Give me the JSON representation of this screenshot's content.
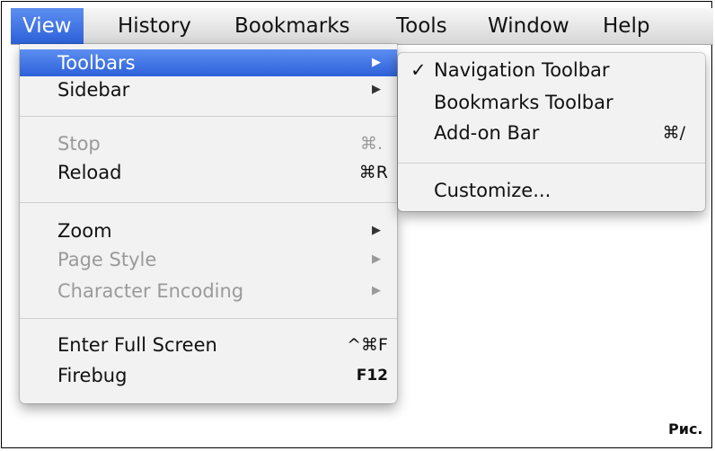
{
  "menubar": {
    "items": [
      {
        "label": "View",
        "active": true
      },
      {
        "label": "History"
      },
      {
        "label": "Bookmarks"
      },
      {
        "label": "Tools"
      },
      {
        "label": "Window"
      },
      {
        "label": "Help"
      }
    ]
  },
  "view_menu": {
    "items": [
      {
        "label": "Toolbars",
        "highlighted": true,
        "submenu": true
      },
      {
        "label": "Sidebar",
        "submenu": true
      },
      {
        "label": "Stop",
        "shortcut": "⌘.",
        "disabled": true
      },
      {
        "label": "Reload",
        "shortcut": "⌘R"
      },
      {
        "label": "Zoom",
        "submenu": true
      },
      {
        "label": "Page Style",
        "submenu": true,
        "disabled": true
      },
      {
        "label": "Character Encoding",
        "submenu": true,
        "disabled": true
      },
      {
        "label": "Enter Full Screen",
        "shortcut": "^⌘F"
      },
      {
        "label": "Firebug",
        "shortcut": "F12"
      }
    ],
    "arrow_glyph": "▶"
  },
  "toolbars_submenu": {
    "items": [
      {
        "label": "Navigation Toolbar",
        "checked": true,
        "check_glyph": "✓"
      },
      {
        "label": "Bookmarks Toolbar"
      },
      {
        "label": "Add-on Bar",
        "shortcut": "⌘/"
      },
      {
        "label": "Customize..."
      }
    ]
  },
  "caption": "Рис.",
  "colors": {
    "highlight": "#3a6fe0",
    "menu_bg": "#f2f2f2",
    "disabled": "#9a9a9a"
  }
}
